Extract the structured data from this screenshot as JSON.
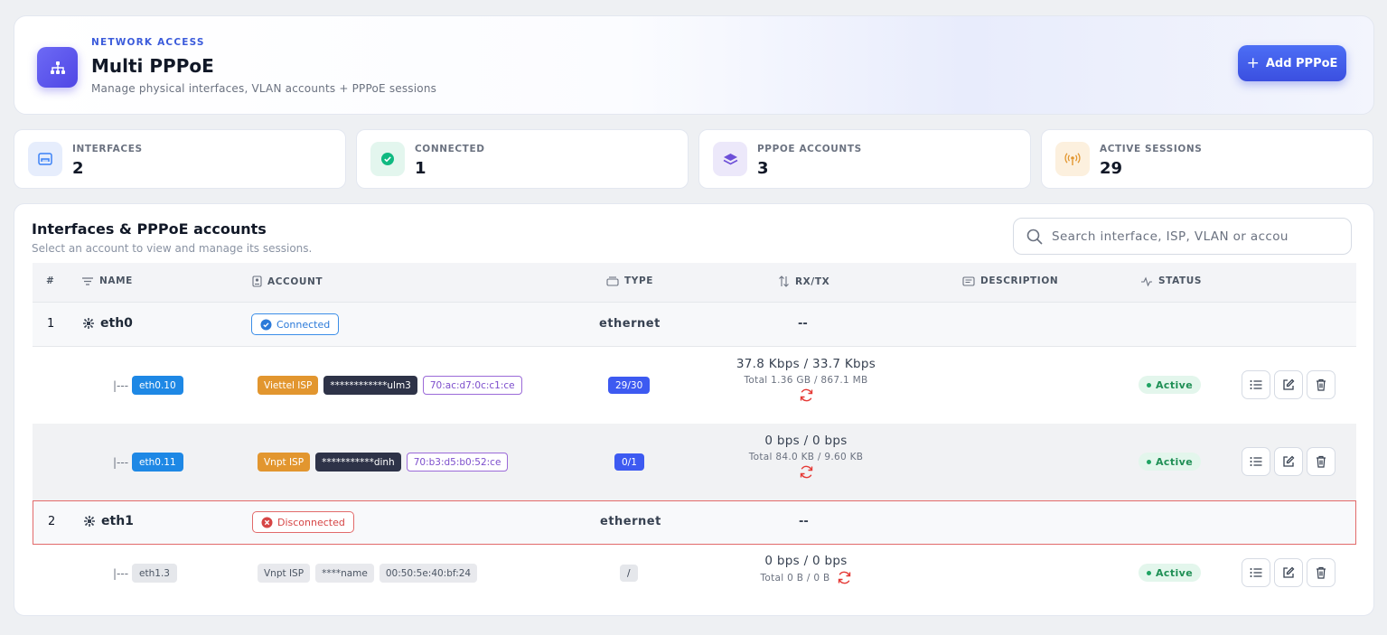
{
  "header": {
    "eyebrow": "NETWORK ACCESS",
    "title": "Multi PPPoE",
    "subtitle": "Manage physical interfaces, VLAN accounts + PPPoE sessions",
    "add_button": "Add PPPoE"
  },
  "stats": [
    {
      "label": "INTERFACES",
      "value": "2",
      "icon": "ethernet-port-icon",
      "color": "#3b82f6"
    },
    {
      "label": "CONNECTED",
      "value": "1",
      "icon": "check-circle-icon",
      "color": "#10b981"
    },
    {
      "label": "PPPOE ACCOUNTS",
      "value": "3",
      "icon": "layers-icon",
      "color": "#6d4fd8"
    },
    {
      "label": "ACTIVE SESSIONS",
      "value": "29",
      "icon": "broadcast-icon",
      "color": "#e2962f"
    }
  ],
  "table": {
    "title": "Interfaces & PPPoE accounts",
    "subtitle": "Select an account to view and manage its sessions.",
    "search_placeholder": "Search interface, ISP, VLAN or accou",
    "columns": [
      "#",
      "NAME",
      "ACCOUNT",
      "TYPE",
      "RX/TX",
      "DESCRIPTION",
      "STATUS"
    ]
  },
  "interfaces": [
    {
      "index": "1",
      "name": "eth0",
      "status": "Connected",
      "type": "ethernet",
      "rxtx": "--",
      "accounts": [
        {
          "tree": "|---",
          "vlan": "eth0.10",
          "isp": "Viettel ISP",
          "user": "************ulm3",
          "mac": "70:ac:d7:0c:c1:ce",
          "sessions": "29/30",
          "rate": "37.8 Kbps / 33.7 Kbps",
          "total": "Total 1.36 GB / 867.1 MB",
          "status": "Active"
        },
        {
          "tree": "|---",
          "vlan": "eth0.11",
          "isp": "Vnpt ISP",
          "user": "***********dinh",
          "mac": "70:b3:d5:b0:52:ce",
          "sessions": "0/1",
          "rate": "0 bps / 0 bps",
          "total": "Total 84.0 KB / 9.60 KB",
          "status": "Active"
        }
      ]
    },
    {
      "index": "2",
      "name": "eth1",
      "status": "Disconnected",
      "type": "ethernet",
      "rxtx": "--",
      "accounts": [
        {
          "tree": "|---",
          "vlan": "eth1.3",
          "isp": "Vnpt ISP",
          "user": "****name",
          "mac": "00:50:5e:40:bf:24",
          "sessions": "/",
          "rate": "0 bps / 0 bps",
          "total": "Total 0 B / 0 B",
          "status": "Active"
        }
      ]
    }
  ]
}
